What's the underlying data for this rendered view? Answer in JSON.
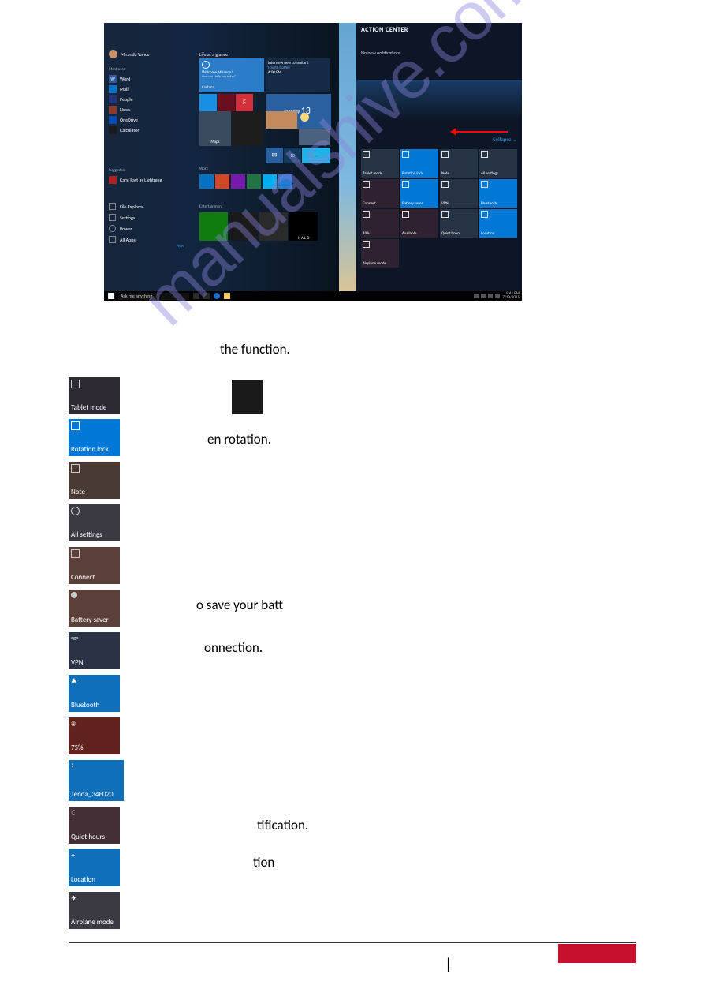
{
  "screenshot": {
    "user": "Miranda Vance",
    "sections": {
      "mostused": "Most used",
      "suggested": "Suggested",
      "glance": "Life at a glance",
      "work": "Work",
      "ent": "Entertainment",
      "new": "New"
    },
    "apps": {
      "word": "Word",
      "mail": "Mail",
      "people": "People",
      "news": "News",
      "onedrive": "OneDrive",
      "calc": "Calculator",
      "cars": "Cars: Fast as Lightning",
      "fe": "File Explorer",
      "settings": "Settings",
      "power": "Power",
      "all": "All Apps"
    },
    "cortana": {
      "hello": "Welcome Miranda!",
      "sub": "How can I help you today?",
      "label": "Cortana"
    },
    "wide": {
      "t": "Interview new consultant",
      "s": "Fourth Coffee",
      "time": "4:00 PM"
    },
    "cal": {
      "day": "Monday",
      "num": "13"
    },
    "maps": "Maps",
    "photos": "Photos",
    "mail2": "Mail",
    "halo": "H A L O",
    "search": "Ask me anything",
    "clock": {
      "time": "8:41 PM",
      "date": "7/19/2015"
    }
  },
  "action_center": {
    "title": "ACTION CENTER",
    "sub": "No new notifications",
    "collapse": "Collapse ⌄",
    "tiles": {
      "tablet": "Tablet mode",
      "rotation": "Rotation lock",
      "note": "Note",
      "allset": "All settings",
      "connect": "Connect",
      "batt": "Battery saver",
      "vpn": "VPN",
      "bt": "Bluetooth",
      "bright": "49%",
      "avail": "Available",
      "quiet": "Quiet hours",
      "loc": "Location",
      "air": "Airplane mode"
    }
  },
  "lines": {
    "l1": "the function.",
    "l2": "en rotation.",
    "l3": "o save your batt",
    "l4": "onnection.",
    "l5": "tification.",
    "l6": "tion"
  },
  "left_tiles": {
    "tablet": "Tablet mode",
    "rotation": "Rotation lock",
    "note": "Note",
    "allset": "All settings",
    "connect": "Connect",
    "batt": "Battery saver",
    "vpn": "VPN",
    "bt": "Bluetooth",
    "bright": "75%",
    "wifi": "Tenda_34E020",
    "quiet": "Quiet hours",
    "loc": "Location",
    "air": "Airplane mode"
  },
  "watermark": "manualshive.com",
  "page_sep": "|"
}
